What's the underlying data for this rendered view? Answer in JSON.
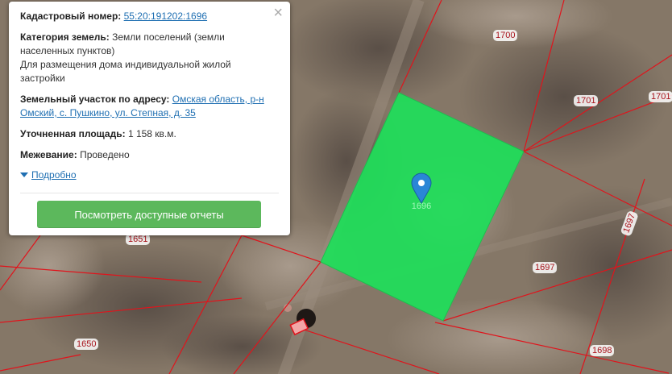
{
  "popup": {
    "close_symbol": "×",
    "cadastral_label": "Кадастровый номер:",
    "cadastral_number": "55:20:191202:1696",
    "category_label": "Категория земель:",
    "category_value_line1": "Земли поселений (земли",
    "category_value_line2": "населенных пунктов)",
    "category_value_line3": "Для размещения дома индивидуальной жилой",
    "category_value_line4": "застройки",
    "address_label": "Земельный участок по адресу:",
    "address_line1": "Омская область, р-н",
    "address_line2": "Омский, с. Пушкино, ул. Степная, д. 35",
    "area_label": "Уточненная площадь:",
    "area_value": "1 158 кв.м.",
    "survey_label": "Межевание:",
    "survey_value": "Проведено",
    "more_label": "Подробно",
    "reports_button": "Посмотреть доступные отчеты"
  },
  "map": {
    "selected_plot_label": "1696",
    "plot_labels": [
      "1700",
      "1701",
      "1701",
      "1697",
      "1697",
      "1651",
      "1650",
      "1698"
    ],
    "selected_color": "#1ee05a",
    "boundary_color": "#e0141c"
  }
}
